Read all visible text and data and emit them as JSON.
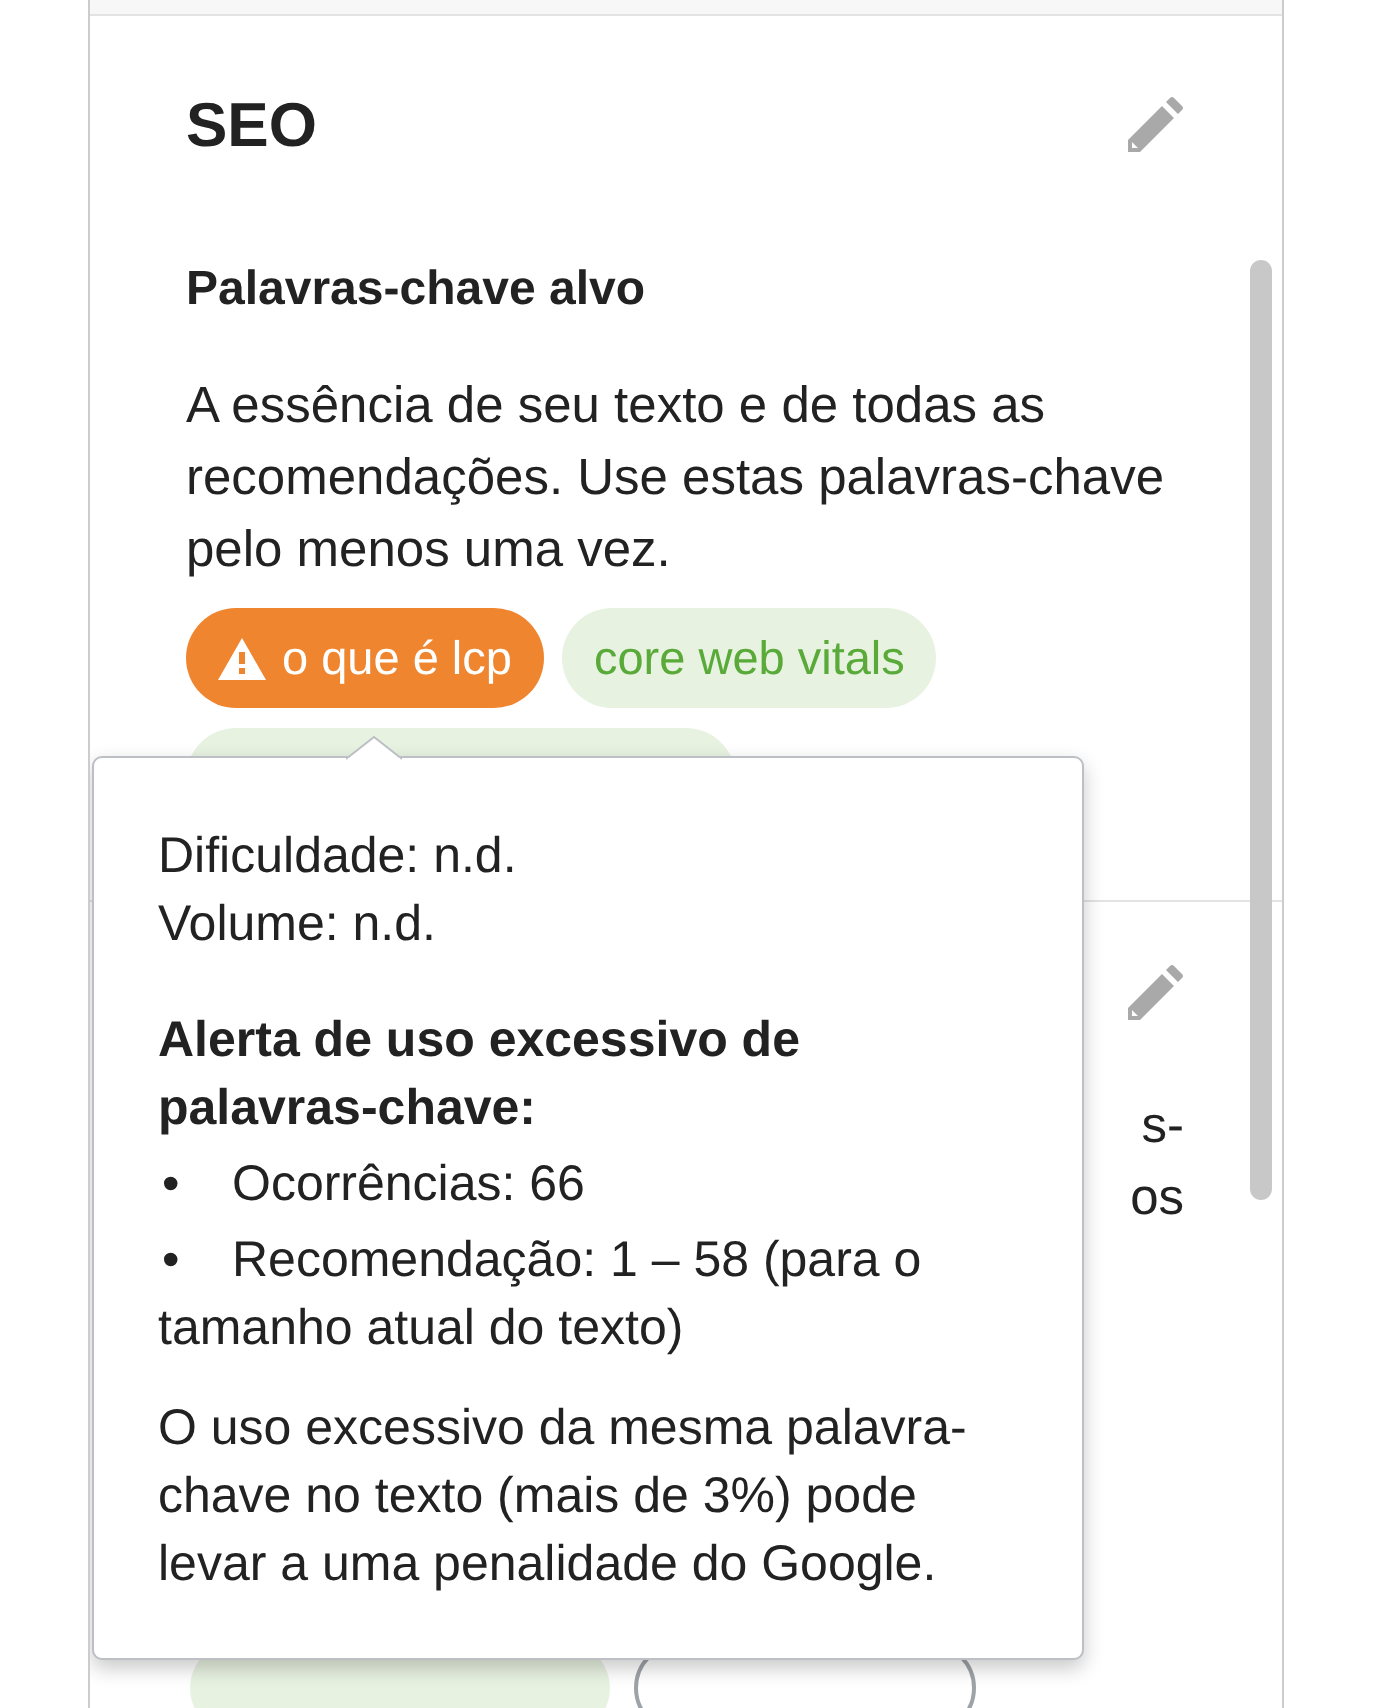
{
  "seo_card": {
    "title": "SEO",
    "subtitle": "Palavras-chave alvo",
    "description": "A essência de seu texto e de todas as recomendações. Use estas palavras-chave pelo menos uma vez.",
    "keywords": [
      {
        "kind": "warning",
        "label": "o que é lcp"
      },
      {
        "kind": "ok",
        "label": "core web vitals"
      },
      {
        "kind": "ok"
      }
    ]
  },
  "next_card": {
    "text_lines": [
      "s-",
      "os"
    ],
    "pills": [
      {
        "kind": "keyword"
      },
      {
        "kind": "outline"
      }
    ]
  },
  "tooltip": {
    "lines": [
      "Dificuldade: n.d.",
      "Volume: n.d."
    ],
    "alert_title": "Alerta de uso excessivo de palavras-chave:",
    "bullets": [
      {
        "marker": "•",
        "text": "Ocorrências: 66"
      },
      {
        "marker": "•",
        "text": "Recomendação: 1 – 58 (para o tamanho atual do texto)"
      }
    ],
    "note": "O uso excessivo da mesma palavra-chave no texto (mais de 3%) pode levar a uma penalidade do Google."
  }
}
